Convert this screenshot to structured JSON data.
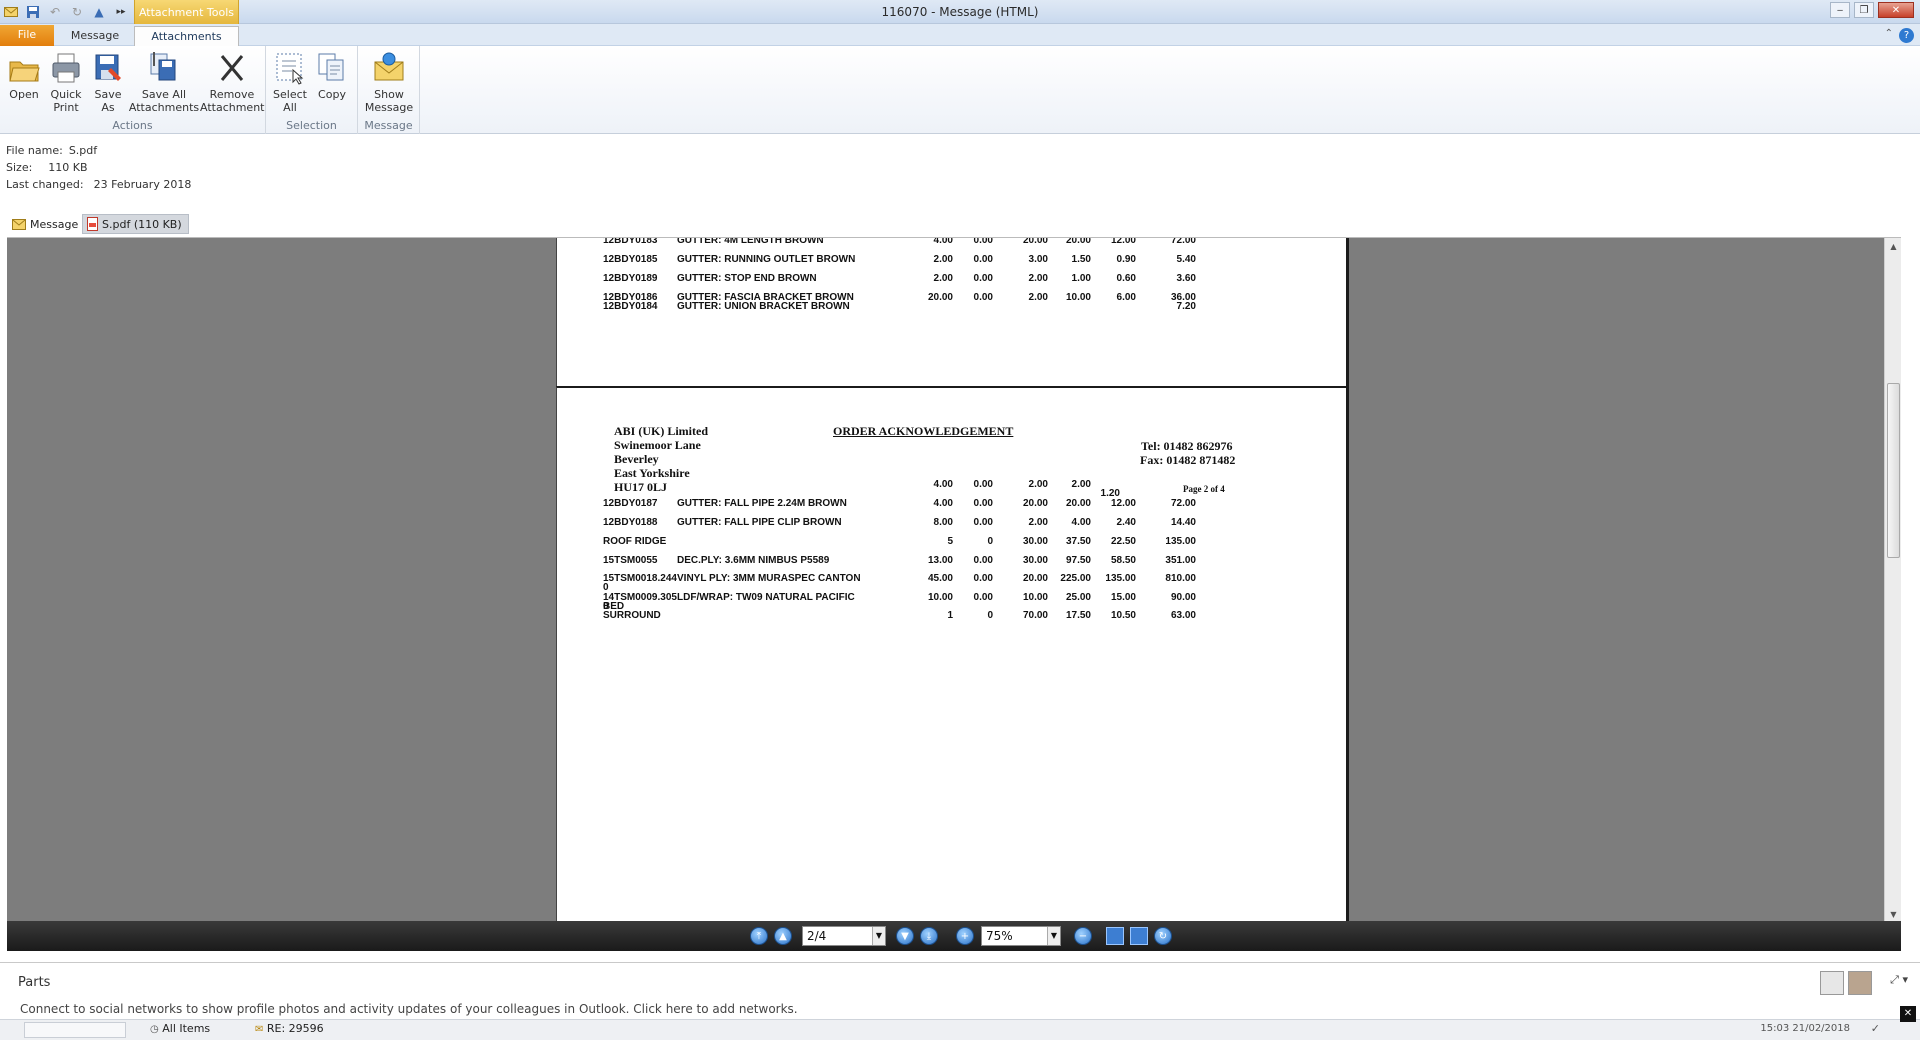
{
  "window": {
    "title": "116070  -  Message (HTML)",
    "context_tab": "Attachment Tools"
  },
  "ribbon": {
    "tabs": {
      "file": "File",
      "message": "Message",
      "attachments": "Attachments"
    },
    "actions": {
      "open": "Open",
      "quick_print_1": "Quick",
      "quick_print_2": "Print",
      "save_as_1": "Save",
      "save_as_2": "As",
      "save_all_1": "Save All",
      "save_all_2": "Attachments",
      "remove_1": "Remove",
      "remove_2": "Attachment",
      "group": "Actions"
    },
    "selection": {
      "select_all_1": "Select",
      "select_all_2": "All",
      "copy": "Copy",
      "group": "Selection"
    },
    "message": {
      "show_1": "Show",
      "show_2": "Message",
      "group": "Message"
    }
  },
  "info": {
    "file_name_label": "File name:",
    "file_name": "S.pdf",
    "size_label": "Size:",
    "size": "110 KB",
    "changed_label": "Last changed:",
    "changed": "23 February 2018"
  },
  "attachments": {
    "message_tab": "Message",
    "pdf_tab": "S.pdf (110 KB)"
  },
  "pdf": {
    "page1_rows": [
      {
        "code": "12BDY0183",
        "desc": "GUTTER: 4M LENGTH BROWN",
        "v": [
          "4.00",
          "0.00",
          "20.00",
          "20.00",
          "12.00",
          "72.00"
        ]
      },
      {
        "code": "12BDY0185",
        "desc": "GUTTER: RUNNING OUTLET BROWN",
        "v": [
          "2.00",
          "0.00",
          "3.00",
          "1.50",
          "0.90",
          "5.40"
        ]
      },
      {
        "code": "12BDY0189",
        "desc": "GUTTER: STOP END BROWN",
        "v": [
          "2.00",
          "0.00",
          "2.00",
          "1.00",
          "0.60",
          "3.60"
        ]
      },
      {
        "code": "12BDY0186",
        "desc": "GUTTER: FASCIA BRACKET BROWN",
        "v": [
          "20.00",
          "0.00",
          "2.00",
          "10.00",
          "6.00",
          "36.00"
        ]
      },
      {
        "code": "12BDY0184",
        "desc": "GUTTER: UNION BRACKET BROWN",
        "v": [
          "",
          "",
          "",
          "",
          "",
          "7.20"
        ]
      }
    ],
    "page2": {
      "company": [
        "ABI (UK) Limited",
        "Swinemoor Lane",
        "Beverley",
        "East Yorkshire",
        "HU17 0LJ"
      ],
      "heading": "ORDER ACKNOWLEDGEMENT",
      "tel": "Tel:   01482 862976",
      "fax": "Fax: 01482 871482",
      "page_of": "Page 2 of 4",
      "carry_row": [
        "4.00",
        "0.00",
        "2.00",
        "2.00",
        "1.20"
      ],
      "rows": [
        {
          "code": "12BDY0187",
          "desc": "GUTTER: FALL PIPE 2.24M BROWN",
          "v": [
            "4.00",
            "0.00",
            "20.00",
            "20.00",
            "12.00",
            "72.00"
          ]
        },
        {
          "code": "12BDY0188",
          "desc": "GUTTER: FALL PIPE CLIP BROWN",
          "v": [
            "8.00",
            "0.00",
            "2.00",
            "4.00",
            "2.40",
            "14.40"
          ]
        },
        {
          "code": "ROOF RIDGE",
          "desc": "",
          "v": [
            "5",
            "0",
            "30.00",
            "37.50",
            "22.50",
            "135.00"
          ]
        },
        {
          "code": "15TSM0055",
          "desc": "DEC.PLY: 3.6MM NIMBUS P5589",
          "v": [
            "13.00",
            "0.00",
            "30.00",
            "97.50",
            "58.50",
            "351.00"
          ]
        },
        {
          "code": "15TSM0018.244",
          "code2": "0",
          "desc": "VINYL PLY: 3MM MURASPEC CANTON",
          "v": [
            "45.00",
            "0.00",
            "20.00",
            "225.00",
            "135.00",
            "810.00"
          ]
        },
        {
          "code": "14TSM0009.305",
          "code2": "0",
          "desc": "LDF/WRAP: TW09 NATURAL PACIFIC",
          "v": [
            "10.00",
            "0.00",
            "10.00",
            "25.00",
            "15.00",
            "90.00"
          ]
        },
        {
          "code": "BED",
          "code2": "SURROUND",
          "desc": "",
          "v": [
            "1",
            "0",
            "70.00",
            "17.50",
            "10.50",
            "63.00"
          ]
        }
      ]
    }
  },
  "toolbar": {
    "page": "2/4",
    "zoom": "75%"
  },
  "people": {
    "title": "Parts",
    "connect": "Connect to social networks to show profile photos and activity updates of your colleagues in Outlook. Click here to add networks."
  },
  "status": {
    "all_items": "All Items",
    "item": "RE: 29596",
    "time": "15:03  21/02/2018"
  }
}
